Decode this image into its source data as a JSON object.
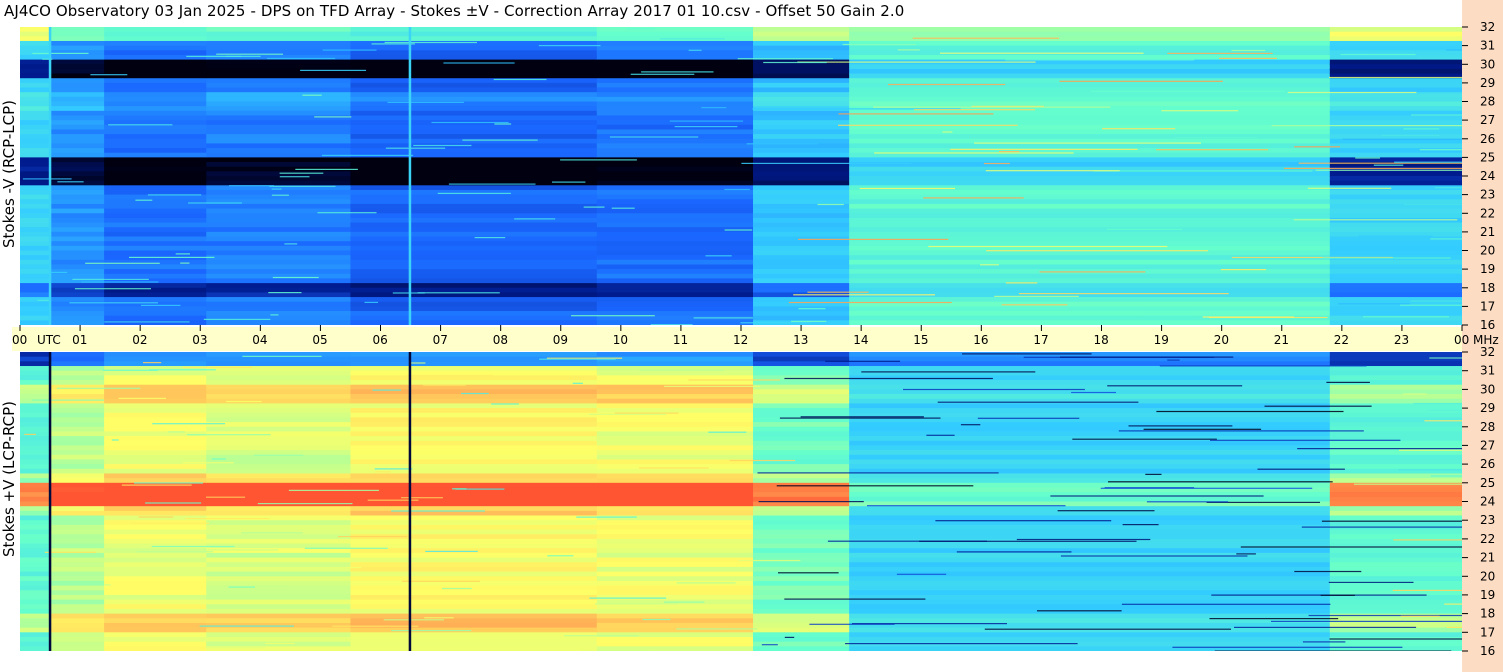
{
  "title": "AJ4CO Observatory  03 Jan 2025  -  DPS on TFD Array  -  Stokes ±V  -  Correction Array 2017 01 10.csv  -  Offset 50  Gain 2.0",
  "colors": {
    "background": "#ffffff",
    "right_strip": "#fcdcc3",
    "time_band": "#ffffcc",
    "colormap": [
      "#000010",
      "#001a8c",
      "#1a66ff",
      "#33ccff",
      "#66ffcc",
      "#ffff66",
      "#ffaa55",
      "#ff5533"
    ]
  },
  "chart_data": [
    {
      "type": "heatmap",
      "panel": "top",
      "ylabel": "Stokes -V (RCP-LCP)",
      "x_unit": "UTC",
      "y_unit": "MHz",
      "xlim": [
        0,
        24
      ],
      "ylim": [
        16,
        32
      ],
      "x_ticks": [
        "00",
        "01",
        "02",
        "03",
        "04",
        "05",
        "06",
        "07",
        "08",
        "09",
        "10",
        "11",
        "12",
        "13",
        "14",
        "15",
        "16",
        "17",
        "18",
        "19",
        "20",
        "21",
        "22",
        "23",
        "00"
      ],
      "y_ticks": [
        "16",
        "17",
        "18",
        "19",
        "20",
        "21",
        "22",
        "23",
        "24",
        "25",
        "26",
        "27",
        "28",
        "29",
        "30",
        "31",
        "32"
      ],
      "time_segments": [
        {
          "t0": 0.0,
          "t1": 0.5,
          "level": 0.45
        },
        {
          "t0": 0.5,
          "t1": 1.4,
          "level": 0.35
        },
        {
          "t0": 1.4,
          "t1": 3.1,
          "level": 0.3
        },
        {
          "t0": 3.1,
          "t1": 5.5,
          "level": 0.32
        },
        {
          "t0": 5.5,
          "t1": 9.6,
          "level": 0.28
        },
        {
          "t0": 9.6,
          "t1": 12.2,
          "level": 0.3
        },
        {
          "t0": 12.2,
          "t1": 13.8,
          "level": 0.42
        },
        {
          "t0": 13.8,
          "t1": 21.8,
          "level": 0.55
        },
        {
          "t0": 21.8,
          "t1": 24.0,
          "level": 0.45
        }
      ]
    },
    {
      "type": "heatmap",
      "panel": "bottom",
      "ylabel": "Stokes +V (LCP-RCP)",
      "x_unit": "UTC",
      "y_unit": "MHz",
      "xlim": [
        0,
        24
      ],
      "ylim": [
        16,
        32
      ],
      "y_ticks": [
        "16",
        "17",
        "18",
        "19",
        "20",
        "21",
        "22",
        "23",
        "24",
        "25",
        "26",
        "27",
        "28",
        "29",
        "30",
        "31",
        "32"
      ],
      "time_segments": [
        {
          "t0": 0.0,
          "t1": 0.5,
          "level": 0.55
        },
        {
          "t0": 0.5,
          "t1": 1.4,
          "level": 0.65
        },
        {
          "t0": 1.4,
          "t1": 3.1,
          "level": 0.7
        },
        {
          "t0": 3.1,
          "t1": 5.5,
          "level": 0.68
        },
        {
          "t0": 5.5,
          "t1": 9.6,
          "level": 0.72
        },
        {
          "t0": 9.6,
          "t1": 12.2,
          "level": 0.7
        },
        {
          "t0": 12.2,
          "t1": 13.8,
          "level": 0.58
        },
        {
          "t0": 13.8,
          "t1": 21.8,
          "level": 0.45
        },
        {
          "t0": 21.8,
          "t1": 24.0,
          "level": 0.55
        }
      ]
    }
  ]
}
